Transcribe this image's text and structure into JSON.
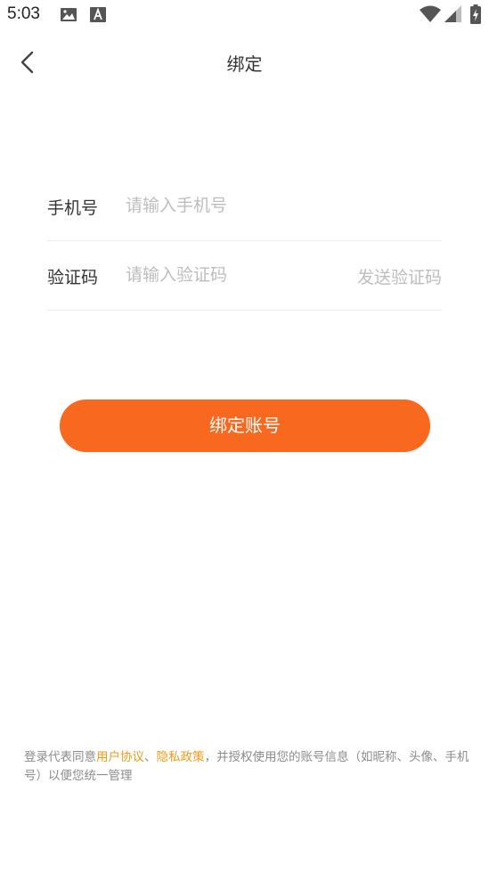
{
  "status_bar": {
    "time": "5:03",
    "icons": [
      "image-icon",
      "a-font-icon",
      "wifi-icon",
      "cellular-icon",
      "battery-icon"
    ]
  },
  "header": {
    "title": "绑定",
    "back_icon": "chevron-left-icon"
  },
  "form": {
    "phone": {
      "label": "手机号",
      "placeholder": "请输入手机号",
      "value": ""
    },
    "code": {
      "label": "验证码",
      "placeholder": "请输入验证码",
      "value": "",
      "send_label": "发送验证码"
    }
  },
  "bind_button": {
    "label": "绑定账号",
    "color": "#f8681f"
  },
  "agreement": {
    "prefix": "登录代表同意",
    "user_agreement": "用户协议",
    "separator": "、",
    "privacy_policy": "隐私政策",
    "suffix": "，并授权使用您的账号信息（如昵称、头像、手机号）以便您统一管理",
    "link_color": "#f39a16"
  }
}
